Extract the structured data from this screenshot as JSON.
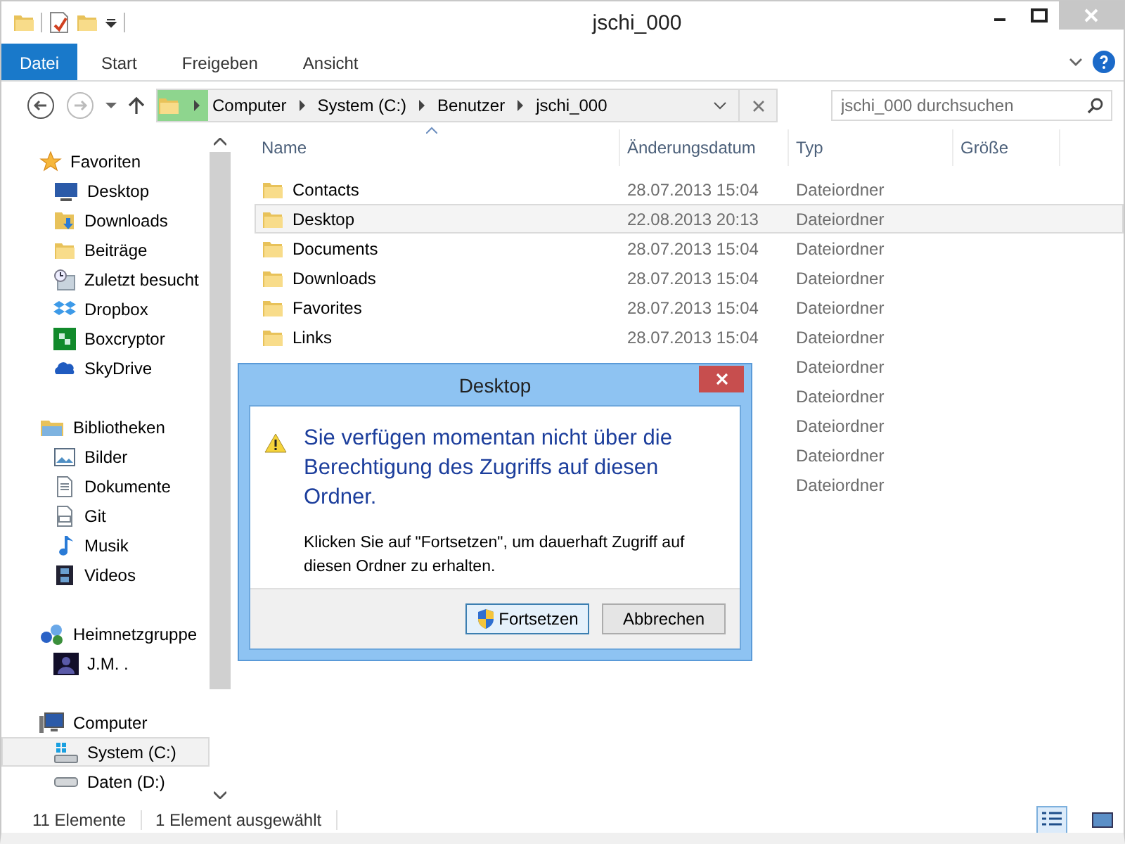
{
  "window": {
    "title": "jschi_000"
  },
  "ribbon": {
    "tabs": [
      {
        "label": "Datei",
        "kind": "file",
        "selected": false
      },
      {
        "label": "Start",
        "kind": "tab",
        "selected": false
      },
      {
        "label": "Freigeben",
        "kind": "tab",
        "selected": false
      },
      {
        "label": "Ansicht",
        "kind": "tab",
        "selected": false
      }
    ]
  },
  "address_bar": {
    "path": [
      "Computer",
      "System (C:)",
      "Benutzer",
      "jschi_000"
    ]
  },
  "search": {
    "placeholder": "jschi_000 durchsuchen"
  },
  "navigation": {
    "sections": [
      {
        "label": "Favoriten",
        "items": [
          {
            "label": "Desktop",
            "selected": false
          },
          {
            "label": "Downloads",
            "selected": false
          },
          {
            "label": "Beiträge",
            "selected": false
          },
          {
            "label": "Zuletzt besucht",
            "selected": false
          },
          {
            "label": "Dropbox",
            "selected": false
          },
          {
            "label": "Boxcryptor",
            "selected": false
          },
          {
            "label": "SkyDrive",
            "selected": false
          }
        ]
      },
      {
        "label": "Bibliotheken",
        "items": [
          {
            "label": "Bilder",
            "selected": false
          },
          {
            "label": "Dokumente",
            "selected": false
          },
          {
            "label": "Git",
            "selected": false
          },
          {
            "label": "Musik",
            "selected": false
          },
          {
            "label": "Videos",
            "selected": false
          }
        ]
      },
      {
        "label": "Heimnetzgruppe",
        "items": [
          {
            "label": "J.M. .",
            "selected": false
          }
        ]
      },
      {
        "label": "Computer",
        "items": [
          {
            "label": "System (C:)",
            "selected": true
          },
          {
            "label": "Daten (D:)",
            "selected": false
          }
        ]
      }
    ]
  },
  "file_list": {
    "columns": [
      "Name",
      "Änderungsdatum",
      "Typ",
      "Größe"
    ],
    "rows": [
      {
        "name": "Contacts",
        "date": "28.07.2013 15:04",
        "type": "Dateiordner",
        "selected": false
      },
      {
        "name": "Desktop",
        "date": "22.08.2013 20:13",
        "type": "Dateiordner",
        "selected": true
      },
      {
        "name": "Documents",
        "date": "28.07.2013 15:04",
        "type": "Dateiordner",
        "selected": false
      },
      {
        "name": "Downloads",
        "date": "28.07.2013 15:04",
        "type": "Dateiordner",
        "selected": false
      },
      {
        "name": "Favorites",
        "date": "28.07.2013 15:04",
        "type": "Dateiordner",
        "selected": false
      },
      {
        "name": "Links",
        "date": "28.07.2013 15:04",
        "type": "Dateiordner",
        "selected": false
      },
      {
        "type": "Dateiordner",
        "selected": false
      },
      {
        "type": "Dateiordner",
        "selected": false
      },
      {
        "type": "Dateiordner",
        "selected": false
      },
      {
        "type": "Dateiordner",
        "selected": false
      },
      {
        "type": "Dateiordner",
        "selected": false
      }
    ]
  },
  "status_bar": {
    "item_count": "11 Elemente",
    "selection": "1 Element ausgewählt",
    "views": [
      {
        "selected": true
      },
      {
        "selected": false
      }
    ]
  },
  "dialog": {
    "title": "Desktop",
    "heading": "Sie verfügen momentan nicht über die Berechtigung des Zugriffs auf diesen Ordner.",
    "message": "Klicken Sie auf \"Fortsetzen\", um dauerhaft Zugriff auf diesen Ordner zu erhalten.",
    "buttons": [
      {
        "label": "Fortsetzen",
        "kind": "shield",
        "default": true
      },
      {
        "label": "Abbrechen",
        "kind": "plain",
        "default": false
      }
    ]
  }
}
